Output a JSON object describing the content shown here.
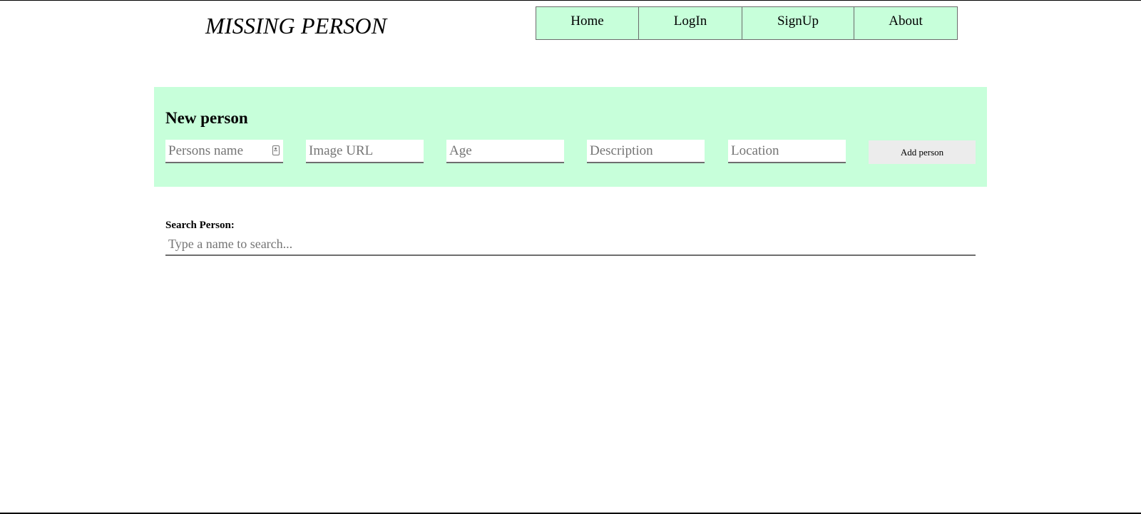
{
  "header": {
    "title": "MISSING PERSON",
    "nav": [
      {
        "label": "Home"
      },
      {
        "label": "LogIn"
      },
      {
        "label": "SignUp"
      },
      {
        "label": "About"
      }
    ]
  },
  "new_person_form": {
    "title": "New person",
    "fields": {
      "name": {
        "placeholder": "Persons name",
        "value": "",
        "icon": "contact-card-icon"
      },
      "image_url": {
        "placeholder": "Image URL",
        "value": ""
      },
      "age": {
        "placeholder": "Age",
        "value": ""
      },
      "description": {
        "placeholder": "Description",
        "value": ""
      },
      "location": {
        "placeholder": "Location",
        "value": ""
      }
    },
    "submit_label": "Add person"
  },
  "search": {
    "label": "Search Person:",
    "placeholder": "Type a name to search...",
    "value": ""
  },
  "colors": {
    "accent_green": "#c7ffda",
    "nav_border": "#6b6b6b",
    "button_gray": "#ececec"
  }
}
